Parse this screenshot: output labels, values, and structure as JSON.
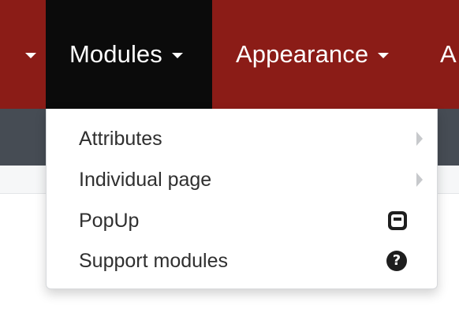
{
  "topnav": {
    "items": [
      {
        "label": "",
        "has_caret": true
      },
      {
        "label": "Modules",
        "has_caret": true,
        "active": true
      },
      {
        "label": "Appearance",
        "has_caret": true
      },
      {
        "label": "A",
        "has_caret": false
      }
    ]
  },
  "dropdown": {
    "items": [
      {
        "label": "Attributes",
        "icon": "chevron-right-icon"
      },
      {
        "label": "Individual page",
        "icon": "chevron-right-icon"
      },
      {
        "label": "PopUp",
        "icon": "popup-window-icon"
      },
      {
        "label": "Support modules",
        "icon": "help-circle-icon",
        "icon_glyph": "?"
      }
    ]
  },
  "colors": {
    "topbar": "#8b1c17",
    "active_tab": "#0b0b0b",
    "subbar": "#464c54",
    "menu_text": "#2f2f2f"
  }
}
